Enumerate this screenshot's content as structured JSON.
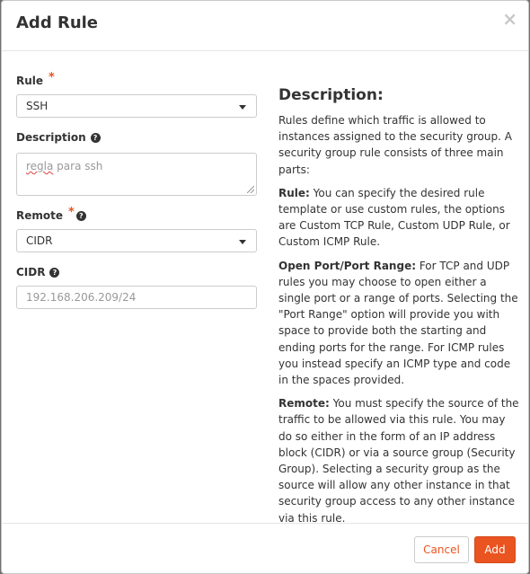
{
  "dialog": {
    "title": "Add Rule",
    "close_label": "×"
  },
  "form": {
    "rule": {
      "label": "Rule",
      "required_mark": "*",
      "value": "SSH"
    },
    "description": {
      "label": "Description",
      "help_icon": "?",
      "value": "regla para ssh",
      "value_first": "regla",
      "value_rest": " para ssh"
    },
    "remote": {
      "label": "Remote",
      "required_mark": "*",
      "help_icon": "?",
      "value": "CIDR"
    },
    "cidr": {
      "label": "CIDR",
      "help_icon": "?",
      "placeholder": "192.168.206.209/24"
    }
  },
  "help": {
    "heading": "Description:",
    "intro": "Rules define which traffic is allowed to instances assigned to the security group. A security group rule consists of three main parts:",
    "rule_term": "Rule:",
    "rule_text": " You can specify the desired rule template or use custom rules, the options are Custom TCP Rule, Custom UDP Rule, or Custom ICMP Rule.",
    "port_term": "Open Port/Port Range:",
    "port_text": " For TCP and UDP rules you may choose to open either a single port or a range of ports. Selecting the \"Port Range\" option will provide you with space to provide both the starting and ending ports for the range. For ICMP rules you instead specify an ICMP type and code in the spaces provided.",
    "remote_term": "Remote:",
    "remote_text": " You must specify the source of the traffic to be allowed via this rule. You may do so either in the form of an IP address block (CIDR) or via a source group (Security Group). Selecting a security group as the source will allow any other instance in that security group access to any other instance via this rule."
  },
  "footer": {
    "cancel_label": "Cancel",
    "add_label": "Add"
  },
  "colors": {
    "accent": "#e95420",
    "required": "#e95420"
  }
}
